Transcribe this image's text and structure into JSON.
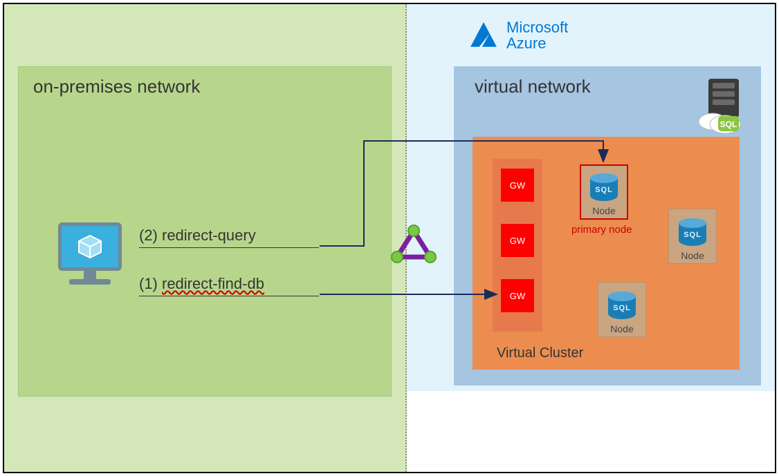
{
  "left": {
    "title": "on-premises network",
    "labels": {
      "redirect_query": "(2) redirect-query",
      "redirect_find_prefix": "(1) ",
      "redirect_find_word": "redirect-find-db"
    }
  },
  "right": {
    "azure_brand_line1": "Microsoft",
    "azure_brand_line2": "Azure",
    "vnet_title": "virtual network",
    "vcluster_title": "Virtual Cluster"
  },
  "gateways": [
    "GW",
    "GW",
    "GW"
  ],
  "nodes": {
    "primary_label": "primary node",
    "items": [
      {
        "label": "Node",
        "primary": true
      },
      {
        "label": "Node",
        "primary": false
      },
      {
        "label": "Node",
        "primary": false
      }
    ]
  },
  "icons": {
    "sql_text": "SQL"
  }
}
